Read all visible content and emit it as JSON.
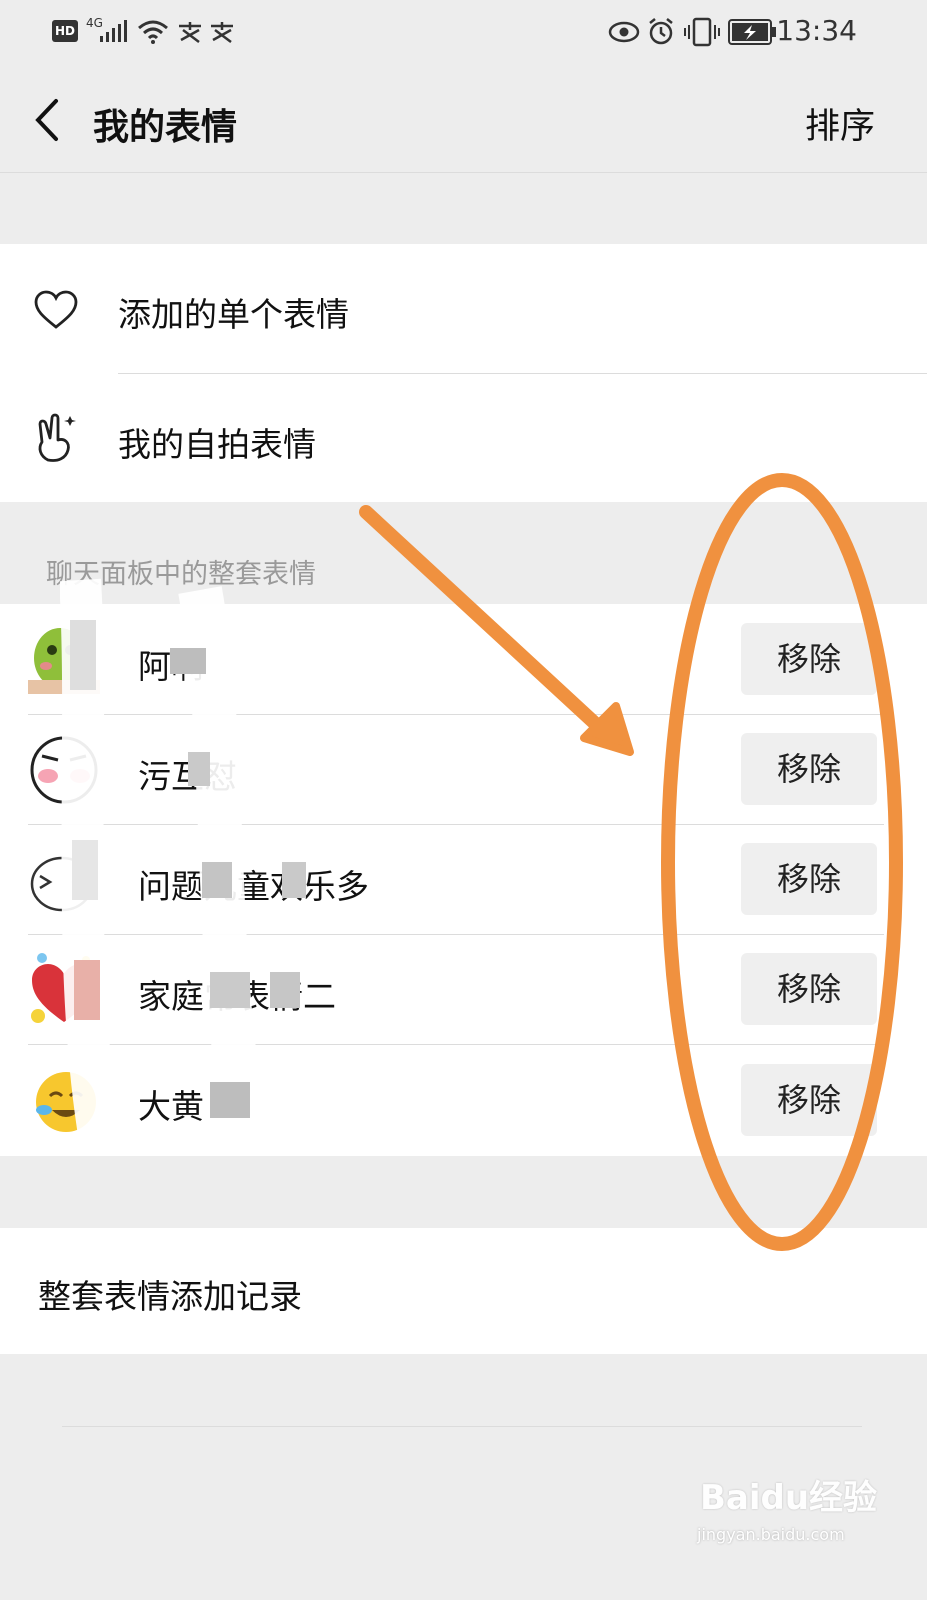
{
  "status_bar": {
    "hd": "HD",
    "network": "4G",
    "time": "13:34"
  },
  "nav": {
    "title": "我的表情",
    "sort_label": "排序"
  },
  "top_items": [
    {
      "label": "添加的单个表情",
      "icon": "heart-icon"
    },
    {
      "label": "我的自拍表情",
      "icon": "victory-hand-icon"
    }
  ],
  "section_header": "聊天面板中的整套表情",
  "packs": [
    {
      "name": "阿啊",
      "button": "移除"
    },
    {
      "name": "污互怼",
      "button": "移除"
    },
    {
      "name": "问题儿童欢乐多",
      "button": "移除"
    },
    {
      "name": "家庭常表情二",
      "button": "移除"
    },
    {
      "name": "大黄",
      "button": "移除"
    }
  ],
  "history_label": "整套表情添加记录",
  "watermark": {
    "brand": "Baidu经验",
    "url": "jingyan.baidu.com"
  },
  "colors": {
    "background": "#ededed",
    "annotation": "#f0913f"
  }
}
